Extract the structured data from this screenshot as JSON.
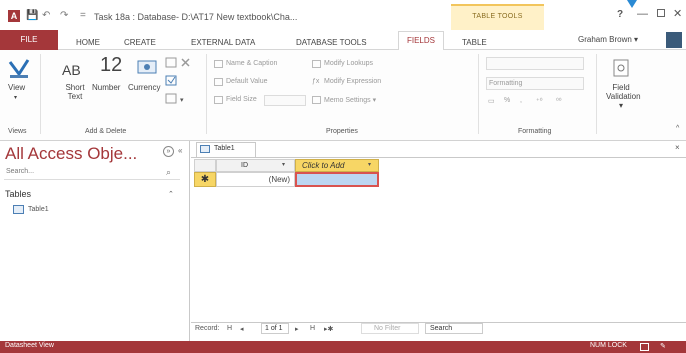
{
  "title_bar": {
    "app_icon": "A",
    "qat_save": "💾",
    "qat_undo": "↶",
    "qat_redo": "↷",
    "qat_customize": "=",
    "title": "Task 18a : Database- D:\\AT17 New textbook\\Cha...",
    "contextual_group": "TABLE TOOLS",
    "help": "?",
    "minimize": "—",
    "close": "✕"
  },
  "tabs": {
    "file": "FILE",
    "home": "HOME",
    "create": "CREATE",
    "external_data": "EXTERNAL DATA",
    "database_tools": "DATABASE TOOLS",
    "fields": "FIELDS",
    "table": "TABLE",
    "user": "Graham Brown ▾"
  },
  "ribbon": {
    "view": {
      "label": "View",
      "arrow": "▾"
    },
    "short_text": {
      "icon": "AB",
      "label": "Short Text"
    },
    "number": {
      "icon": "12",
      "label": "Number"
    },
    "currency": {
      "label": "Currency"
    },
    "more_fields_arrow": "▾",
    "name_caption": "Name & Caption",
    "default_value": "Default Value",
    "field_size": "Field Size",
    "modify_lookups": "Modify Lookups",
    "modify_expression": "Modify Expression",
    "memo_settings": "Memo Settings ▾",
    "formatting_dropdown": "Formatting",
    "format_percent": "%",
    "format_comma": ",",
    "field_validation": "Field Validation ▾",
    "groups": {
      "views": "Views",
      "add_delete": "Add & Delete",
      "properties": "Properties",
      "formatting": "Formatting"
    },
    "collapse": "^"
  },
  "nav_pane": {
    "title": "All Access Obje...",
    "chevron": "»",
    "collapse": "«",
    "search_placeholder": "Search...",
    "search_icon": "⌕",
    "section": "Tables",
    "section_chevron": "⌃",
    "table_item": "Table1"
  },
  "document": {
    "tab_label": "Table1",
    "close": "×"
  },
  "datasheet": {
    "col_id": "ID",
    "col_add": "Click to Add",
    "dropdown_arrow": "▾",
    "new_row_marker": "✱",
    "new_row_value": "(New)"
  },
  "record_nav": {
    "label": "Record:",
    "first": "H",
    "prev": "◂",
    "current": "1 of 1",
    "next": "▸",
    "last": "H",
    "new": "▸✱",
    "filter": "No Filter",
    "search": "Search"
  },
  "status_bar": {
    "text": "Datasheet View",
    "numlock": "NUM LOCK",
    "design_view": "✎"
  }
}
